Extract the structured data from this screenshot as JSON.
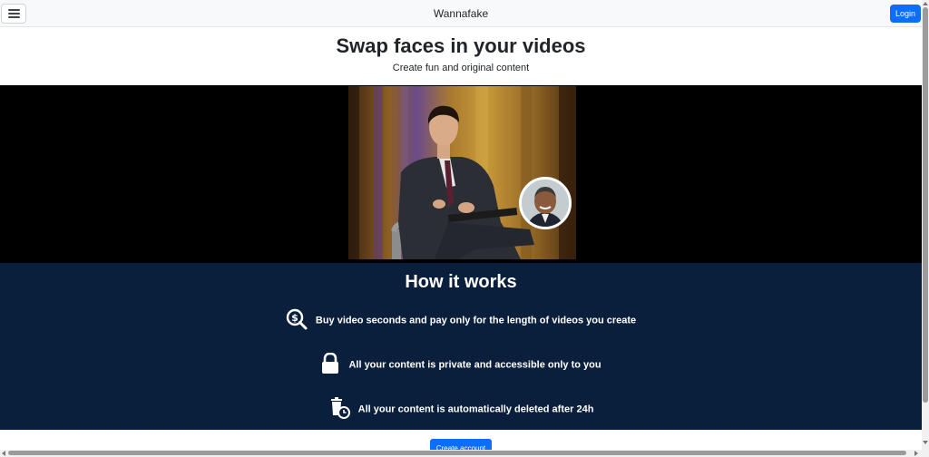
{
  "navbar": {
    "brand": "Wannafake",
    "login_label": "Login",
    "menu_icon": "hamburger-icon"
  },
  "hero": {
    "title": "Swap faces in your videos",
    "subtitle": "Create fun and original content"
  },
  "how_it_works": {
    "title": "How it works",
    "features": [
      {
        "icon": "search-dollar-icon",
        "text": "Buy video seconds and pay only for the length of videos you create"
      },
      {
        "icon": "lock-icon",
        "text": "All your content is private and accessible only to you"
      },
      {
        "icon": "trash-clock-icon",
        "text": "All your content is automatically deleted after 24h"
      }
    ]
  },
  "cta": {
    "create_account_label": "Create account"
  },
  "colors": {
    "primary": "#0d6efd",
    "section_bg": "#0a1f3c",
    "navbar_bg": "#f8f9fa",
    "video_bg": "#000000"
  }
}
